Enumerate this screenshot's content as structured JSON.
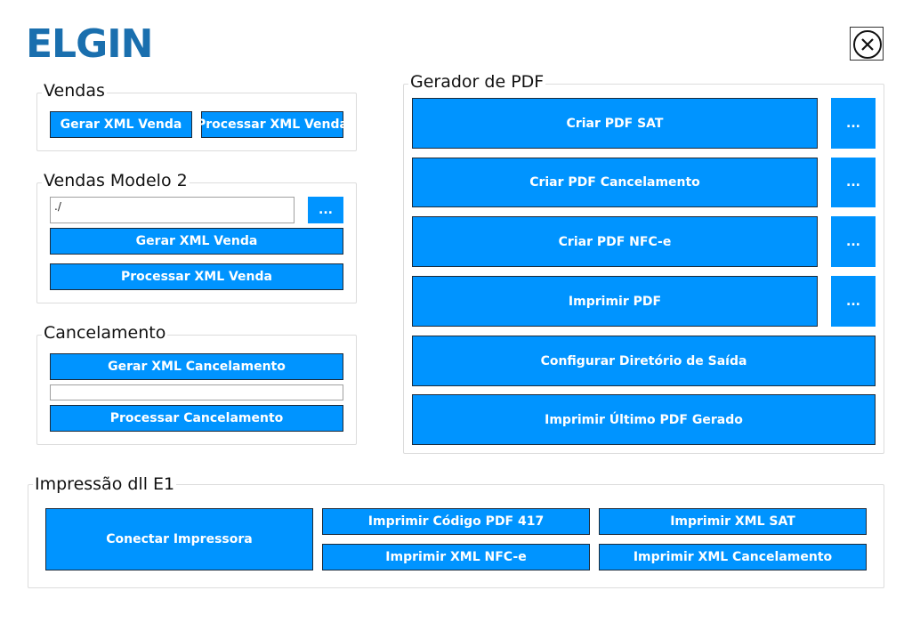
{
  "brand": {
    "logo": "ELGIN"
  },
  "vendas": {
    "title": "Vendas",
    "gerar_label": "Gerar XML Venda",
    "processar_label": "Processar XML Venda"
  },
  "vendas2": {
    "title": "Vendas Modelo 2",
    "path_value": "./",
    "browse_label": "...",
    "gerar_label": "Gerar XML Venda",
    "processar_label": "Processar XML Venda"
  },
  "cancelamento": {
    "title": "Cancelamento",
    "gerar_label": "Gerar XML Cancelamento",
    "field_value": "",
    "processar_label": "Processar Cancelamento"
  },
  "gerador_pdf": {
    "title": "Gerador de PDF",
    "criar_sat_label": "Criar PDF SAT",
    "criar_cancelamento_label": "Criar PDF Cancelamento",
    "criar_nfce_label": "Criar PDF NFC-e",
    "imprimir_pdf_label": "Imprimir PDF",
    "browse_label": "...",
    "configurar_label": "Configurar Diretório de Saída",
    "imprimir_ultimo_label": "Imprimir Último PDF Gerado"
  },
  "impressao": {
    "title": "Impressão dll E1",
    "conectar_label": "Conectar Impressora",
    "codigo_pdf417_label": "Imprimir Código PDF 417",
    "xml_sat_label": "Imprimir XML SAT",
    "xml_nfce_label": "Imprimir XML NFC-e",
    "xml_cancelamento_label": "Imprimir XML Cancelamento"
  },
  "colors": {
    "button": "#0094ff",
    "logo": "#1a6fae"
  },
  "icons": {
    "close": "close-circle-icon"
  }
}
